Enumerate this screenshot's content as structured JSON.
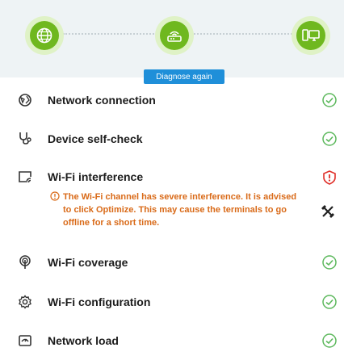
{
  "diagnose": {
    "label": "Diagnose again"
  },
  "nodes": [
    {
      "icon": "internet-globe-icon"
    },
    {
      "icon": "router-icon"
    },
    {
      "icon": "terminal-devices-icon"
    }
  ],
  "items": [
    {
      "label": "Network connection",
      "icon": "network-globe-icon",
      "status": "ok"
    },
    {
      "label": "Device self-check",
      "icon": "stethoscope-icon",
      "status": "ok"
    },
    {
      "label": "Wi-Fi interference",
      "icon": "wifi-interference-icon",
      "status": "error",
      "warning": "The Wi-Fi channel has severe interference. It is advised to click Optimize. This may cause the terminals to go offline for a short time.",
      "action_icon": "optimize-tools-icon"
    },
    {
      "label": "Wi-Fi coverage",
      "icon": "wifi-coverage-icon",
      "status": "ok"
    },
    {
      "label": "Wi-Fi configuration",
      "icon": "gear-icon",
      "status": "ok"
    },
    {
      "label": "Network load",
      "icon": "load-gauge-icon",
      "status": "ok"
    }
  ],
  "colors": {
    "ok": "#5cb85c",
    "error": "#e0302a",
    "warning_text": "#d96a18",
    "accent": "#1f8fd9",
    "node_green": "#6fb81f"
  }
}
